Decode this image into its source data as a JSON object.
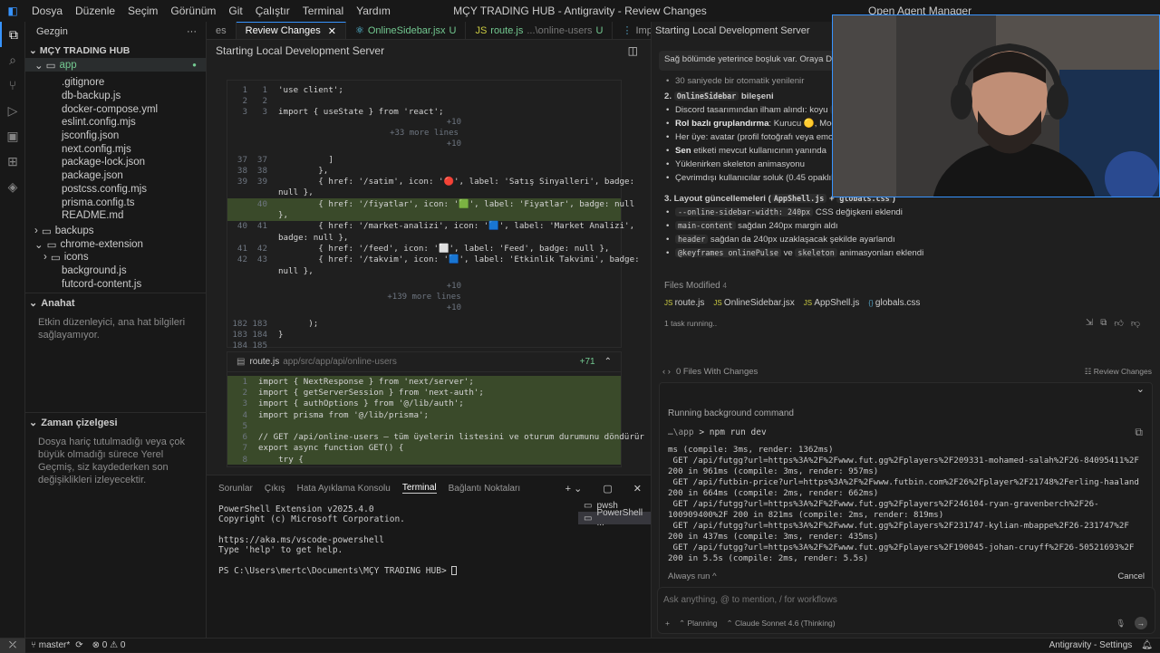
{
  "titlebar": {
    "menu": [
      "Dosya",
      "Düzenle",
      "Seçim",
      "Görünüm",
      "Git",
      "Çalıştır",
      "Terminal",
      "Yardım"
    ],
    "title": "MÇY TRADING HUB - Antigravity - Review Changes",
    "open_agent_manager": "Open Agent Manager"
  },
  "sidebar": {
    "header": "Gezgin",
    "project": "MÇY TRADING HUB",
    "folder_app": "app",
    "files": [
      ".gitignore",
      "db-backup.js",
      "docker-compose.yml",
      "eslint.config.mjs",
      "jsconfig.json",
      "next.config.mjs",
      "package-lock.json",
      "package.json",
      "postcss.config.mjs",
      "prisma.config.ts",
      "README.md"
    ],
    "folders": [
      "backups",
      "chrome-extension"
    ],
    "ext_items": [
      "icons",
      "background.js",
      "futcord-content.js"
    ],
    "outline_title": "Anahat",
    "outline_text": "Etkin düzenleyici, ana hat bilgileri sağlayamıyor.",
    "timeline_title": "Zaman çizelgesi",
    "timeline_text": "Dosya hariç tutulmadığı veya çok büyük olmadığı sürece Yerel Geçmiş, siz kaydederken son değişiklikleri izleyecektir."
  },
  "editor": {
    "tabs": [
      "es",
      "Review Changes",
      "OnlineSidebar.jsx",
      "route.js",
      "Impl"
    ],
    "tab_suffix_u": "U",
    "route_path": "...\\online-users",
    "crumb": "Starting Local Development Server",
    "hunk_10": "+10",
    "more_33": "+33 more lines",
    "more_139": "+139 more lines",
    "file2_name": "route.js",
    "file2_path": "app/src/app/api/online-users",
    "file2_count": "+71",
    "diff1": [
      {
        "n1": "1",
        "n2": "1",
        "code": "'use client';"
      },
      {
        "n1": "2",
        "n2": "2",
        "code": ""
      },
      {
        "n1": "3",
        "n2": "3",
        "code": "import { useState } from 'react';"
      }
    ],
    "diff2": [
      {
        "n1": "37",
        "n2": "37",
        "code": "          ]"
      },
      {
        "n1": "38",
        "n2": "38",
        "code": "        },"
      },
      {
        "n1": "39",
        "n2": "39",
        "code": "        { href: '/satim', icon: '🔴', label: 'Satış Sinyalleri', badge:"
      },
      {
        "n1": "",
        "n2": "",
        "code": "null },"
      },
      {
        "n1": "",
        "n2": "40",
        "code": "        { href: '/fiyatlar', icon: '🟩', label: 'Fiyatlar', badge: null",
        "add": true
      },
      {
        "n1": "",
        "n2": "",
        "code": "},",
        "add": true
      },
      {
        "n1": "40",
        "n2": "41",
        "code": "        { href: '/market-analizi', icon: '🟦', label: 'Market Analizi',"
      },
      {
        "n1": "",
        "n2": "",
        "code": "badge: null },"
      },
      {
        "n1": "41",
        "n2": "42",
        "code": "        { href: '/feed', icon: '⬜', label: 'Feed', badge: null },"
      },
      {
        "n1": "42",
        "n2": "43",
        "code": "        { href: '/takvim', icon: '🟦', label: 'Etkinlik Takvimi', badge:"
      },
      {
        "n1": "",
        "n2": "",
        "code": "null },"
      }
    ],
    "diff3": [
      {
        "n1": "182",
        "n2": "183",
        "code": "      );"
      },
      {
        "n1": "183",
        "n2": "184",
        "code": "}"
      },
      {
        "n1": "184",
        "n2": "185",
        "code": ""
      }
    ],
    "diff4": [
      {
        "n1": "1",
        "code": "import { NextResponse } from 'next/server';"
      },
      {
        "n1": "2",
        "code": "import { getServerSession } from 'next-auth';"
      },
      {
        "n1": "3",
        "code": "import { authOptions } from '@/lib/auth';"
      },
      {
        "n1": "4",
        "code": "import prisma from '@/lib/prisma';"
      },
      {
        "n1": "5",
        "code": ""
      },
      {
        "n1": "6",
        "code": "// GET /api/online-users — tüm üyelerin listesini ve oturum durumunu döndürür"
      },
      {
        "n1": "7",
        "code": "export async function GET() {"
      },
      {
        "n1": "8",
        "code": "    try {"
      }
    ]
  },
  "panel": {
    "tabs": [
      "Sorunlar",
      "Çıkış",
      "Hata Ayıklama Konsolu",
      "Terminal",
      "Bağlantı Noktaları"
    ],
    "terminal_text": "PowerShell Extension v2025.4.0\nCopyright (c) Microsoft Corporation.\n\nhttps://aka.ms/vscode-powershell\nType 'help' to get help.\n\nPS C:\\Users\\mertc\\Documents\\MÇY TRADING HUB> ",
    "term_list": [
      "pwsh",
      "PowerShell ..."
    ]
  },
  "agent": {
    "header": "Starting Local Development Server",
    "intro": "Sağ bölümde yeterince boşluk var. Oraya Discord",
    "line_30s": "30 saniyede bir otomatik yenilenir",
    "h2_num": "2.",
    "h2_chip": "OnlineSidebar",
    "h2_text": "bileşeni",
    "b1": "Discord tasarımından ilham alındı: koyu",
    "b1_chip": "#0d13",
    "b2_bold": "Rol bazlı gruplandırma",
    "b2": ": Kurucu 🟡, Moderat",
    "b3": "Her üye: avatar (profil fotoğrafı veya emoji/init",
    "b4_bold": "Sen",
    "b4": " etiketi mevcut kullanıcının yanında",
    "b5": "Yüklenirken skeleton animasyonu",
    "b6": "Çevrimdışı kullanıcılar soluk (0.45 opaklık)",
    "h3_text": "3. Layout güncellemeleri (",
    "h3_chip1": "AppShell.js",
    "h3_plus": " + ",
    "h3_chip2": "globals.css",
    "h3_close": ")",
    "c1_chip": "--online-sidebar-width: 240px",
    "c1": " CSS değişkeni eklendi",
    "c2_chip": "main-content",
    "c2": " sağdan 240px margin aldı",
    "c3_chip": "header",
    "c3": " sağdan da 240px uzaklaşacak şekilde ayarlandı",
    "c4_chip1": "@keyframes onlinePulse",
    "c4_ve": " ve ",
    "c4_chip2": "skeleton",
    "c4": " animasyonları eklendi",
    "files_modified": "Files Modified",
    "files_count": "4",
    "files": [
      "route.js",
      "OnlineSidebar.jsx",
      "AppShell.js",
      "globals.css"
    ],
    "task_running": "1 task running..",
    "no_changes": "0 Files With Changes",
    "review_changes": "Review Changes",
    "running_cmd": "Running background command",
    "cwd": "…\\app",
    "cmd": "npm run dev",
    "output": "ms (compile: 3ms, render: 1362ms)\n GET /api/futgg?url=https%3A%2F%2Fwww.fut.gg%2Fplayers%2F209331-mohamed-salah%2F26-84095411%2F 200 in 961ms (compile: 3ms, render: 957ms)\n GET /api/futbin-price?url=https%3A%2F%2Fwww.futbin.com%2F26%2Fplayer%2F21748%2Ferling-haaland 200 in 664ms (compile: 2ms, render: 662ms)\n GET /api/futgg?url=https%3A%2F%2Fwww.fut.gg%2Fplayers%2F246104-ryan-gravenberch%2F26-100909400%2F 200 in 821ms (compile: 2ms, render: 819ms)\n GET /api/futgg?url=https%3A%2F%2Fwww.fut.gg%2Fplayers%2F231747-kylian-mbappe%2F26-231747%2F 200 in 437ms (compile: 3ms, render: 435ms)\n GET /api/futgg?url=https%3A%2F%2Fwww.fut.gg%2Fplayers%2F190045-johan-cruyff%2F26-50521693%2F 200 in 5.5s (compile: 2ms, render: 5.5s)",
    "always_run": "Always run ^",
    "cancel": "Cancel",
    "input_placeholder": "Ask anything, @ to mention, / for workflows",
    "mode": "Planning",
    "model": "Claude Sonnet 4.6 (Thinking)"
  },
  "statusbar": {
    "branch": "master*",
    "problems": "⊗ 0 ⚠ 0",
    "right": "Antigravity - Settings"
  }
}
